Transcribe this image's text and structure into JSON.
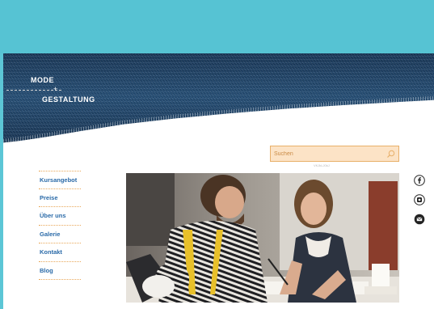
{
  "logo": {
    "line1": "MODE",
    "plus": "+",
    "line2": "GESTALTUNG"
  },
  "search": {
    "placeholder": "Suchen",
    "caption": "VKJkLJ0kJ"
  },
  "nav": {
    "items": [
      {
        "label": "Kursangebot"
      },
      {
        "label": "Preise"
      },
      {
        "label": "Über uns"
      },
      {
        "label": "Galerie"
      },
      {
        "label": "Kontakt"
      },
      {
        "label": "Blog"
      }
    ]
  },
  "social": {
    "icons": [
      "facebook-icon",
      "instagram-icon",
      "mail-icon"
    ]
  },
  "colors": {
    "top_bar": "#56c3d3",
    "nav_text": "#2a6aa8",
    "nav_divider": "#e9a85a",
    "search_bg": "#fce3c6",
    "search_border": "#e8b06a"
  }
}
